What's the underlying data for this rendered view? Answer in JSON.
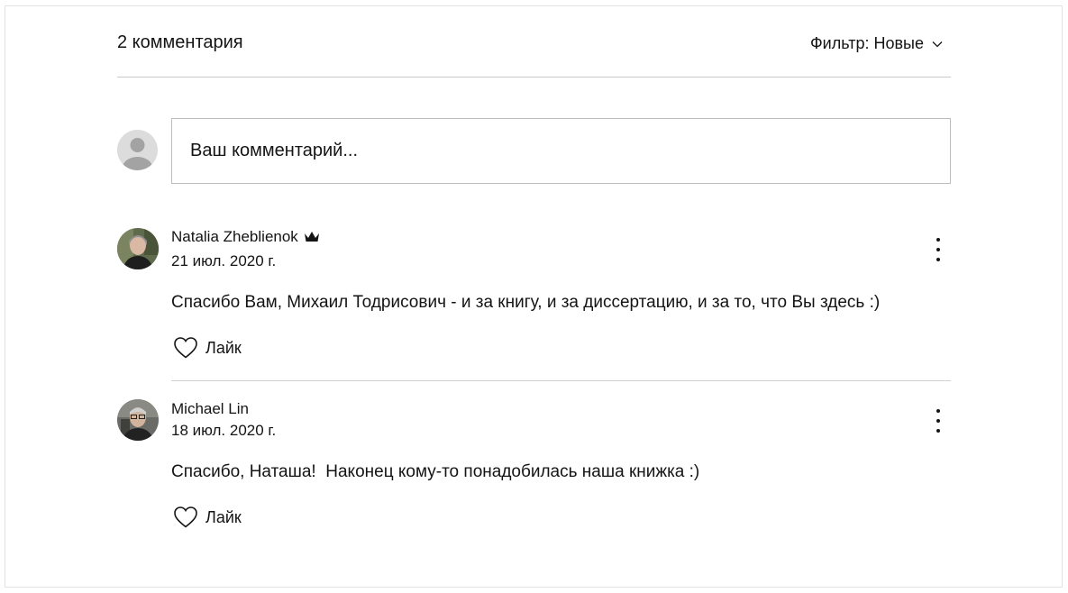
{
  "header": {
    "count_label": "2 комментария",
    "filter_label": "Фильтр: Новые"
  },
  "new_comment": {
    "placeholder": "Ваш комментарий..."
  },
  "comments": [
    {
      "author": "Natalia Zheblienok",
      "badge_icon": "crown-icon",
      "date": "21 июл. 2020 г.",
      "text": "Спасибо Вам, Михаил Тодрисович - и за книгу, и за диссертацию, и за то, что Вы здесь :)",
      "like_label": "Лайк"
    },
    {
      "author": "Michael Lin",
      "date": "18 июл. 2020 г.",
      "text": "Спасибо, Наташа!  Наконец кому-то понадобилась наша книжка :)",
      "like_label": "Лайк"
    }
  ]
}
